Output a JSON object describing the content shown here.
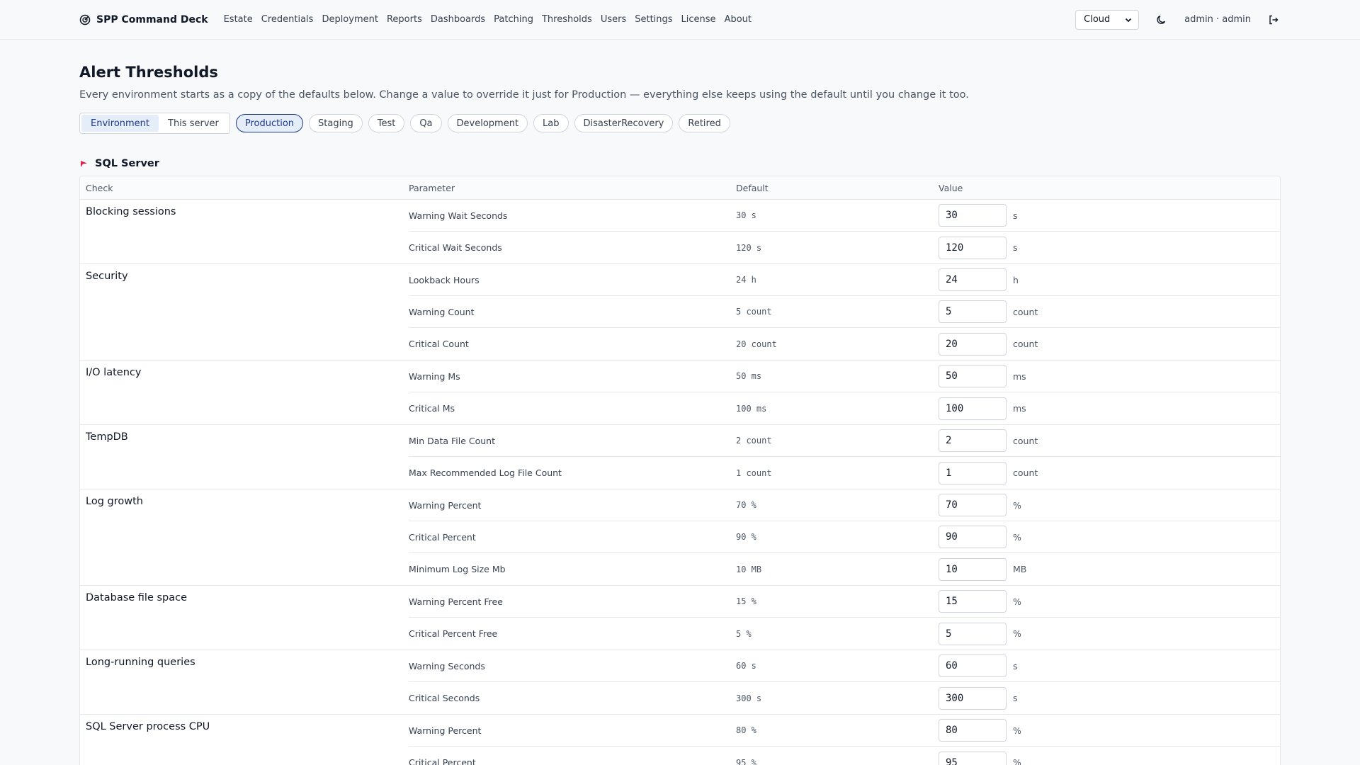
{
  "brand": {
    "name": "SPP Command Deck",
    "icon": "gauge-icon"
  },
  "nav": [
    "Estate",
    "Credentials",
    "Deployment",
    "Reports",
    "Dashboards",
    "Patching",
    "Thresholds",
    "Users",
    "Settings",
    "License",
    "About"
  ],
  "toolbar": {
    "mode_select": "Cloud",
    "theme_icon": "moon-icon",
    "user": "admin · admin",
    "logout_icon": "logout-icon"
  },
  "page": {
    "title": "Alert Thresholds",
    "subtitle": "Every environment starts as a copy of the defaults below. Change a value to override it just for Production — everything else keeps using the default until you change it too."
  },
  "scope_toggle": {
    "options": [
      "Environment",
      "This server"
    ],
    "selected": "Environment"
  },
  "environments": {
    "options": [
      "Production",
      "Staging",
      "Test",
      "Qa",
      "Development",
      "Lab",
      "DisasterRecovery",
      "Retired"
    ],
    "selected": "Production"
  },
  "section": {
    "title": "SQL Server",
    "icon": "flag-icon"
  },
  "table": {
    "headers": {
      "check": "Check",
      "parameter": "Parameter",
      "default": "Default",
      "value": "Value"
    },
    "groups": [
      {
        "name": "Blocking sessions",
        "rows": [
          {
            "parameter": "Warning Wait Seconds",
            "default": "30 s",
            "value": "30",
            "unit": "s"
          },
          {
            "parameter": "Critical Wait Seconds",
            "default": "120 s",
            "value": "120",
            "unit": "s"
          }
        ]
      },
      {
        "name": "Security",
        "rows": [
          {
            "parameter": "Lookback Hours",
            "default": "24 h",
            "value": "24",
            "unit": "h"
          },
          {
            "parameter": "Warning Count",
            "default": "5 count",
            "value": "5",
            "unit": "count"
          },
          {
            "parameter": "Critical Count",
            "default": "20 count",
            "value": "20",
            "unit": "count"
          }
        ]
      },
      {
        "name": "I/O latency",
        "rows": [
          {
            "parameter": "Warning Ms",
            "default": "50 ms",
            "value": "50",
            "unit": "ms"
          },
          {
            "parameter": "Critical Ms",
            "default": "100 ms",
            "value": "100",
            "unit": "ms"
          }
        ]
      },
      {
        "name": "TempDB",
        "rows": [
          {
            "parameter": "Min Data File Count",
            "default": "2 count",
            "value": "2",
            "unit": "count"
          },
          {
            "parameter": "Max Recommended Log File Count",
            "default": "1 count",
            "value": "1",
            "unit": "count"
          }
        ]
      },
      {
        "name": "Log growth",
        "rows": [
          {
            "parameter": "Warning Percent",
            "default": "70 %",
            "value": "70",
            "unit": "%"
          },
          {
            "parameter": "Critical Percent",
            "default": "90 %",
            "value": "90",
            "unit": "%"
          },
          {
            "parameter": "Minimum Log Size Mb",
            "default": "10 MB",
            "value": "10",
            "unit": "MB"
          }
        ]
      },
      {
        "name": "Database file space",
        "rows": [
          {
            "parameter": "Warning Percent Free",
            "default": "15 %",
            "value": "15",
            "unit": "%"
          },
          {
            "parameter": "Critical Percent Free",
            "default": "5 %",
            "value": "5",
            "unit": "%"
          }
        ]
      },
      {
        "name": "Long-running queries",
        "rows": [
          {
            "parameter": "Warning Seconds",
            "default": "60 s",
            "value": "60",
            "unit": "s"
          },
          {
            "parameter": "Critical Seconds",
            "default": "300 s",
            "value": "300",
            "unit": "s"
          }
        ]
      },
      {
        "name": "SQL Server process CPU",
        "rows": [
          {
            "parameter": "Warning Percent",
            "default": "80 %",
            "value": "80",
            "unit": "%"
          },
          {
            "parameter": "Critical Percent",
            "default": "95 %",
            "value": "95",
            "unit": "%"
          }
        ]
      }
    ]
  },
  "colors": {
    "accent": "#1e3a8a",
    "accent_bg": "#e5edf9",
    "section_flag": "#e11d48"
  }
}
